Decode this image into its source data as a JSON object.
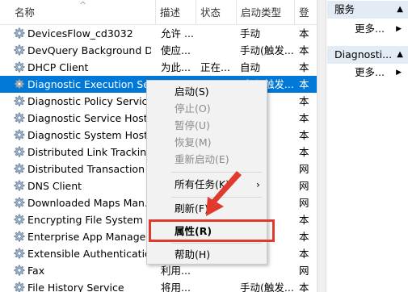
{
  "columns": {
    "name": "名称",
    "description": "描述",
    "status": "状态",
    "startup_type": "启动类型",
    "logon_as": "登"
  },
  "services": [
    {
      "name": "DevicesFlow_cd3032",
      "description": "允许 ...",
      "status": "",
      "startup_type": "手动",
      "logon_as": "本"
    },
    {
      "name": "DevQuery Background D...",
      "description": "使应...",
      "status": "",
      "startup_type": "手动(触发...",
      "logon_as": "本"
    },
    {
      "name": "DHCP Client",
      "description": "为此...",
      "status": "正在...",
      "startup_type": "自动",
      "logon_as": "本"
    },
    {
      "name": "Diagnostic Execution Ser...",
      "description": "",
      "status": "",
      "startup_type": "手动(触发...",
      "logon_as": "本"
    },
    {
      "name": "Diagnostic Policy Service",
      "description": "",
      "status": "",
      "startup_type": "",
      "logon_as": "本"
    },
    {
      "name": "Diagnostic Service Host",
      "description": "",
      "status": "",
      "startup_type": "",
      "logon_as": "本"
    },
    {
      "name": "Diagnostic System Host",
      "description": "",
      "status": "",
      "startup_type": "",
      "logon_as": "本"
    },
    {
      "name": "Distributed Link Tracking",
      "description": "",
      "status": "",
      "startup_type": "",
      "logon_as": "本"
    },
    {
      "name": "Distributed Transaction C",
      "description": "",
      "status": "",
      "startup_type": "",
      "logon_as": "网"
    },
    {
      "name": "DNS Client",
      "description": "",
      "status": "",
      "startup_type": "发...",
      "logon_as": "网"
    },
    {
      "name": "Downloaded Maps Man...",
      "description": "",
      "status": "",
      "startup_type": "迟...",
      "logon_as": "网"
    },
    {
      "name": "Encrypting File System (E...",
      "description": "",
      "status": "",
      "startup_type": "发...",
      "logon_as": "本"
    },
    {
      "name": "Enterprise App Manage...",
      "description": "",
      "status": "",
      "startup_type": "",
      "logon_as": "本"
    },
    {
      "name": "Extensible Authentication...",
      "description": "",
      "status": "",
      "startup_type": "",
      "logon_as": "本"
    },
    {
      "name": "Fax",
      "description": "利用...",
      "status": "",
      "startup_type": "",
      "logon_as": "网"
    },
    {
      "name": "File History Service",
      "description": "将用...",
      "status": "",
      "startup_type": "手动(触发...",
      "logon_as": "本"
    }
  ],
  "actions_panel": {
    "section1_title": "服务",
    "section1_more": "更多...",
    "section2_title": "Diagnosti...",
    "section2_more": "更多..."
  },
  "context_menu": {
    "start": "启动(S)",
    "stop": "停止(O)",
    "pause": "暂停(U)",
    "resume": "恢复(M)",
    "restart": "重新启动(E)",
    "all_tasks": "所有任务(K)",
    "refresh": "刷新(F)",
    "properties": "属性(R)",
    "help": "帮助(H)"
  },
  "colors": {
    "selection": "#0078d7",
    "annotation": "#e03a2e"
  }
}
